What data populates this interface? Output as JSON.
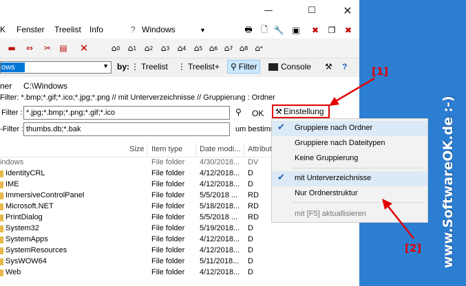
{
  "menu": {
    "items": [
      "K",
      "Fenster",
      "Treelist",
      "Info"
    ],
    "question": "?",
    "path_value": "Windows"
  },
  "toolbar": {
    "recent_labels": [
      "0",
      "1",
      "2",
      "3",
      "4",
      "5",
      "6",
      "7",
      "8",
      "*"
    ]
  },
  "addressbar": {
    "value": "ows"
  },
  "viewbar": {
    "by_label": "by:",
    "treelist": "Treelist",
    "treelist_plus": "Treelist+",
    "filter": "Filter",
    "console": "Console"
  },
  "panel": {
    "name_label": "ner",
    "name_value": "C:\\Windows",
    "summary": "Filter: *.bmp;*.gif;*.ico;*.jpg;*.png  //  mit Unterverzeichnisse // Gruppierung : Ordner",
    "filter_label": "Filter :",
    "filter_value": "*.jpg;*.bmp;*.png;*.gif;*.ico",
    "ok_label": "OK",
    "einstellung_label": "Einstellung",
    "exclude_label": "-Filter :",
    "exclude_value": "thumbs.db;*.bak",
    "um_label": "um bestimm"
  },
  "columns": {
    "size": "Size",
    "type": "Item type",
    "date": "Date modi...",
    "attr": "Attribut"
  },
  "group_header": {
    "name": "indows",
    "type": "File folder",
    "date": "4/30/2018...",
    "attr": "DV"
  },
  "rows": [
    {
      "name": "IdentityCRL",
      "type": "File folder",
      "date": "4/12/2018...",
      "attr": "D"
    },
    {
      "name": "IME",
      "type": "File folder",
      "date": "4/12/2018...",
      "attr": "D"
    },
    {
      "name": "ImmersiveControlPanel",
      "type": "File folder",
      "date": "5/5/2018 ...",
      "attr": "RD"
    },
    {
      "name": "Microsoft.NET",
      "type": "File folder",
      "date": "5/18/2018...",
      "attr": "RD"
    },
    {
      "name": "PrintDialog",
      "type": "File folder",
      "date": "5/5/2018 ...",
      "attr": "RD"
    },
    {
      "name": "System32",
      "type": "File folder",
      "date": "5/19/2018...",
      "attr": "D"
    },
    {
      "name": "SystemApps",
      "type": "File folder",
      "date": "4/12/2018...",
      "attr": "D"
    },
    {
      "name": "SystemResources",
      "type": "File folder",
      "date": "4/12/2018...",
      "attr": "D"
    },
    {
      "name": "SysWOW64",
      "type": "File folder",
      "date": "5/11/2018...",
      "attr": "D"
    },
    {
      "name": "Web",
      "type": "File folder",
      "date": "4/12/2018...",
      "attr": "D"
    }
  ],
  "popup": {
    "items": [
      {
        "label": "Gruppiere nach Ordner",
        "checked": true
      },
      {
        "label": "Gruppiere nach Dateitypen",
        "checked": false
      },
      {
        "label": "Keine Gruppierung",
        "checked": false
      },
      {
        "label": "mit Unterverzeichnisse",
        "checked": true
      },
      {
        "label": "Nur Ordnerstruktur",
        "checked": false
      },
      {
        "label": "mit [F5] aktuallisieren",
        "checked": false,
        "disabled": true
      }
    ]
  },
  "callouts": {
    "one": "[1]",
    "two": "[2]"
  },
  "watermark": "www.SoftwareOK.de :-)",
  "colors": {
    "accent": "#2c7ed2",
    "callout": "#e00000",
    "selection": "#0078d7"
  }
}
